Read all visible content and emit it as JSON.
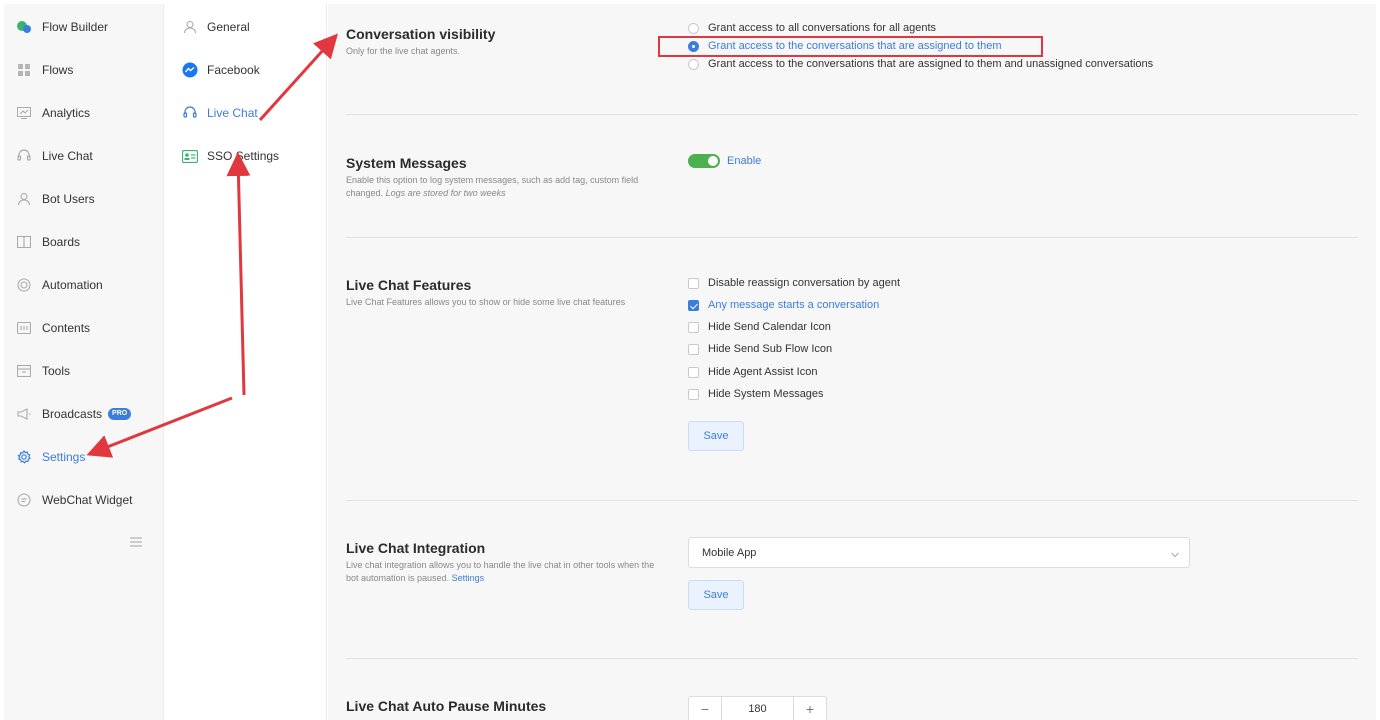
{
  "nav": {
    "items": [
      {
        "label": "Flow Builder",
        "icon": "flow-builder-icon"
      },
      {
        "label": "Flows",
        "icon": "grid-icon"
      },
      {
        "label": "Analytics",
        "icon": "analytics-icon"
      },
      {
        "label": "Live Chat",
        "icon": "headset-icon"
      },
      {
        "label": "Bot Users",
        "icon": "user-icon"
      },
      {
        "label": "Boards",
        "icon": "board-icon"
      },
      {
        "label": "Automation",
        "icon": "automation-icon"
      },
      {
        "label": "Contents",
        "icon": "contents-icon"
      },
      {
        "label": "Tools",
        "icon": "tools-icon"
      },
      {
        "label": "Broadcasts",
        "icon": "megaphone-icon",
        "badge": "PRO"
      },
      {
        "label": "Settings",
        "icon": "gear-icon"
      },
      {
        "label": "WebChat Widget",
        "icon": "chat-icon"
      }
    ]
  },
  "subnav": {
    "items": [
      {
        "label": "General",
        "icon": "user-icon"
      },
      {
        "label": "Facebook",
        "icon": "messenger-icon"
      },
      {
        "label": "Live Chat",
        "icon": "headset-icon"
      },
      {
        "label": "SSO Settings",
        "icon": "id-card-icon"
      }
    ]
  },
  "visibility": {
    "title": "Conversation visibility",
    "desc": "Only for the live chat agents.",
    "options": [
      "Grant access to all conversations for all agents",
      "Grant access to the conversations that are assigned to them",
      "Grant access to the conversations that are assigned to them and unassigned conversations"
    ],
    "selected_index": 1
  },
  "system_messages": {
    "title": "System Messages",
    "desc": "Enable this option to log system messages, such as add tag, custom field changed.",
    "desc_em": "Logs are stored for two weeks",
    "toggle_label": "Enable",
    "enabled": true
  },
  "features": {
    "title": "Live Chat Features",
    "desc": "Live Chat Features allows you to show or hide some live chat features",
    "options": [
      {
        "label": "Disable reassign conversation by agent",
        "checked": false
      },
      {
        "label": "Any message starts a conversation",
        "checked": true
      },
      {
        "label": "Hide Send Calendar Icon",
        "checked": false
      },
      {
        "label": "Hide Send Sub Flow Icon",
        "checked": false
      },
      {
        "label": "Hide Agent Assist Icon",
        "checked": false
      },
      {
        "label": "Hide System Messages",
        "checked": false
      }
    ],
    "save_label": "Save"
  },
  "integration": {
    "title": "Live Chat Integration",
    "desc": "Live chat integration allows you to handle the live chat in other tools when the bot automation is paused.",
    "desc_link": "Settings",
    "select_value": "Mobile App",
    "save_label": "Save"
  },
  "auto_pause": {
    "title": "Live Chat Auto Pause Minutes",
    "minus": "−",
    "value": "180",
    "plus": "+"
  },
  "colors": {
    "accent": "#3b7ddd",
    "toggle_on": "#4caf50",
    "annotation": "#e0383e"
  }
}
